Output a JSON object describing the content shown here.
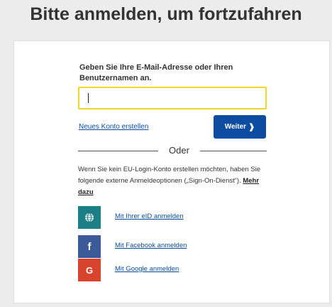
{
  "page": {
    "title": "Bitte anmelden, um fortzufahren"
  },
  "login": {
    "prompt": "Geben Sie Ihre E-Mail-Adresse oder Ihren Benutzernamen an.",
    "username_value": "",
    "create_account_label": "Neues Konto erstellen",
    "next_label": "Weiter",
    "next_icon": "chevron-right-icon",
    "or_label": "Oder"
  },
  "external": {
    "info_text": "Wenn Sie kein EU-Login-Konto erstellen möchten, haben Sie folgende externe Anmeldeoptionen („Sign-On-Dienst“). ",
    "more_label": "Mehr dazu",
    "providers": [
      {
        "label": "Mit Ihrer eID anmelden",
        "icon": "globe-icon",
        "glyph": "",
        "color": "#1d7f86"
      },
      {
        "label": "Mit Facebook anmelden",
        "icon": "facebook-icon",
        "glyph": "f",
        "color": "#3d5a98"
      },
      {
        "label": "Mit Google anmelden",
        "icon": "google-icon",
        "glyph": "G",
        "color": "#d8432e"
      }
    ]
  },
  "colors": {
    "accent": "#0c4da2",
    "input_focus": "#f1d52b"
  }
}
